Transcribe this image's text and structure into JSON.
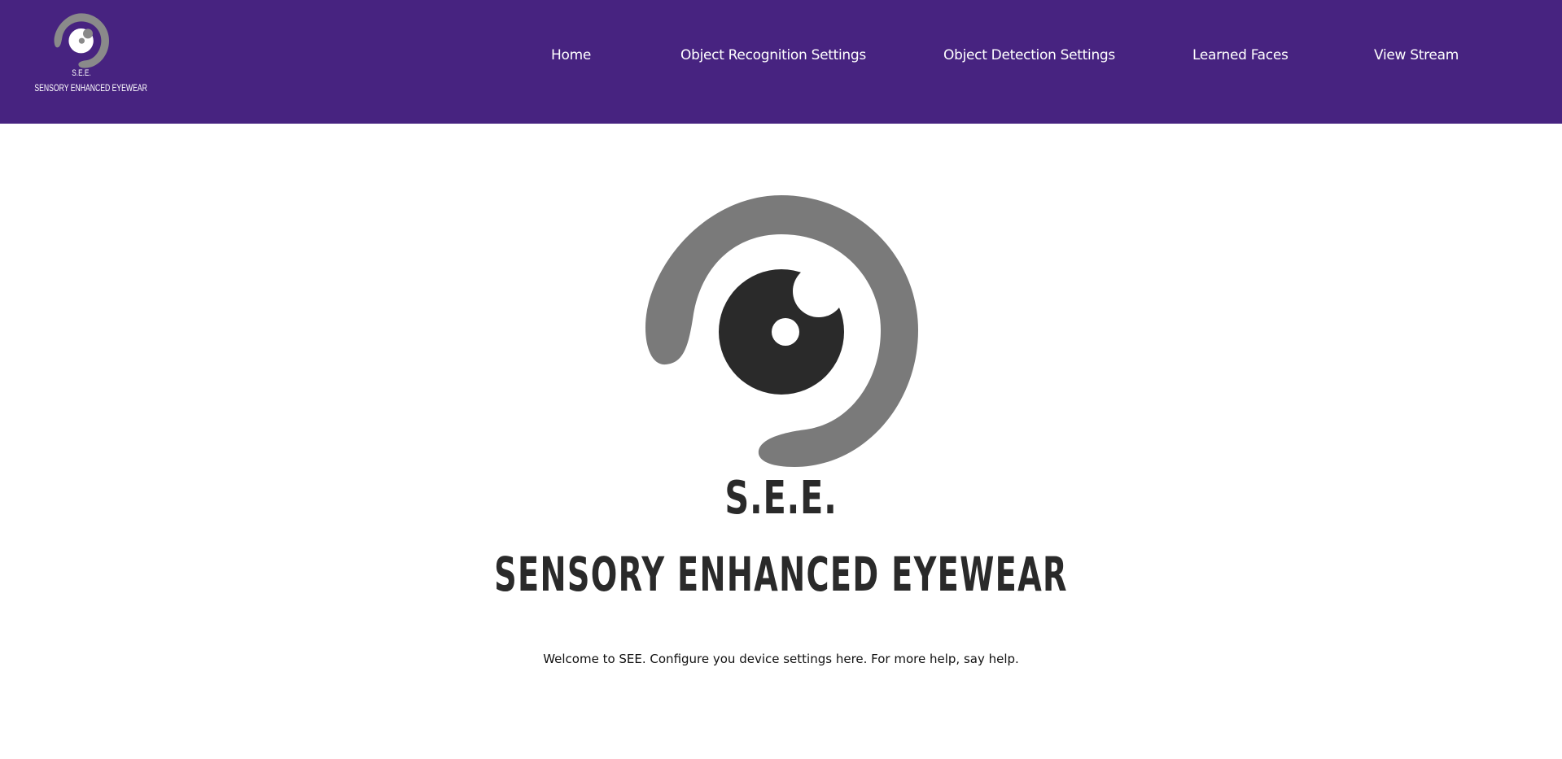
{
  "colors": {
    "navbar_bg": "#472380",
    "nav_text": "#ffffff",
    "logo_ring": "#7a7a7a",
    "logo_eye": "#2a2a2a",
    "body_text": "#111111"
  },
  "nav_logo": {
    "icon": "eye-logo-icon",
    "abbr": "S.E.E.",
    "name": "SENSORY ENHANCED EYEWEAR"
  },
  "nav": {
    "items": [
      {
        "label": "Home"
      },
      {
        "label": "Object Recognition Settings"
      },
      {
        "label": "Object Detection Settings"
      },
      {
        "label": "Learned Faces"
      },
      {
        "label": "View Stream"
      }
    ]
  },
  "hero": {
    "icon": "eye-logo-icon",
    "abbr": "S.E.E.",
    "name": "SENSORY ENHANCED EYEWEAR",
    "welcome": "Welcome to SEE. Configure you device settings here. For more help, say help."
  }
}
